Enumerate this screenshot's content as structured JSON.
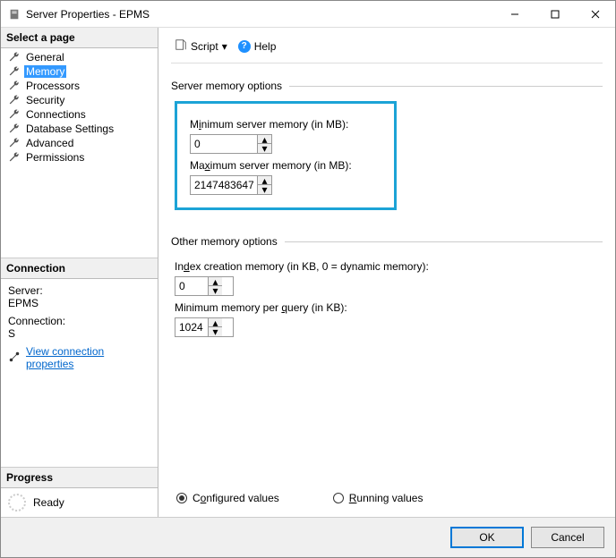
{
  "window": {
    "title": "Server Properties - EPMS"
  },
  "titlebar": {
    "min": "Minimize",
    "max": "Maximize",
    "close": "Close"
  },
  "left": {
    "select_page": "Select a page",
    "pages": [
      "General",
      "Memory",
      "Processors",
      "Security",
      "Connections",
      "Database Settings",
      "Advanced",
      "Permissions"
    ],
    "selected_index": 1,
    "connection_head": "Connection",
    "server_label": "Server:",
    "server_value": "EPMS",
    "connection_label": "Connection:",
    "connection_value": "S",
    "view_props": "View connection properties",
    "progress_head": "Progress",
    "progress_status": "Ready"
  },
  "toolbar": {
    "script": "Script",
    "help": "Help"
  },
  "main": {
    "server_memory_title": "Server memory options",
    "min_label_pre": "M",
    "min_label_und": "i",
    "min_label_post": "nimum server memory (in MB):",
    "min_value": "0",
    "max_label_pre": "Ma",
    "max_label_und": "x",
    "max_label_post": "imum server memory (in MB):",
    "max_value": "2147483647",
    "other_title": "Other memory options",
    "index_label_pre": "In",
    "index_label_und": "d",
    "index_label_post": "ex creation memory (in KB, 0 = dynamic memory):",
    "index_value": "0",
    "minq_label_pre": "Minimum memory per ",
    "minq_label_und": "q",
    "minq_label_post": "uery (in KB):",
    "minq_value": "1024",
    "configured_pre": "C",
    "configured_und": "o",
    "configured_post": "nfigured values",
    "running_und": "R",
    "running_post": "unning values"
  },
  "footer": {
    "ok": "OK",
    "cancel": "Cancel"
  }
}
